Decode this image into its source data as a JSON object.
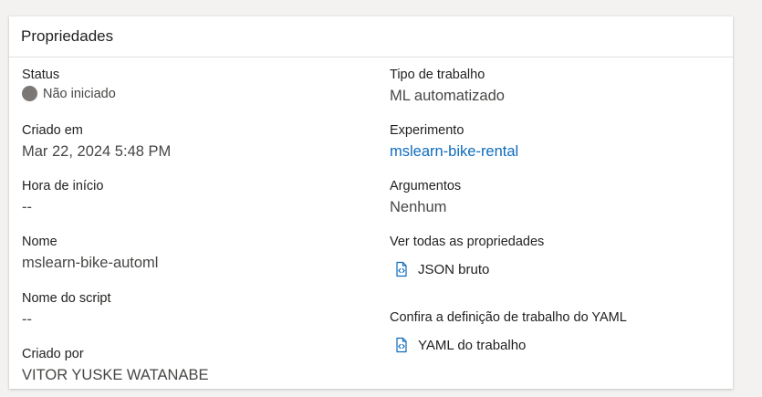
{
  "panel": {
    "title": "Propriedades"
  },
  "left": {
    "status": {
      "label": "Status",
      "value": "Não iniciado"
    },
    "created": {
      "label": "Criado em",
      "value": "Mar 22, 2024 5:48 PM"
    },
    "start_time": {
      "label": "Hora de início",
      "value": "--"
    },
    "name": {
      "label": "Nome",
      "value": "mslearn-bike-automl"
    },
    "script_name": {
      "label": "Nome do script",
      "value": "--"
    },
    "created_by": {
      "label": "Criado por",
      "value": "VITOR YUSKE WATANABE"
    }
  },
  "right": {
    "job_type": {
      "label": "Tipo de trabalho",
      "value": "ML automatizado"
    },
    "experiment": {
      "label": "Experimento",
      "value": "mslearn-bike-rental"
    },
    "arguments": {
      "label": "Argumentos",
      "value": "Nenhum"
    },
    "all_properties": {
      "label": "Ver todas as propriedades",
      "link": "JSON bruto"
    },
    "yaml": {
      "label": "Confira a definição de trabalho do YAML",
      "link": "YAML do trabalho"
    }
  },
  "icons": {
    "status": "status-dot-icon",
    "json": "code-file-icon",
    "yaml": "code-file-icon"
  },
  "colors": {
    "link": "#0f6cbd",
    "icon": "#0f6cbd",
    "status_dot": "#7a7775"
  }
}
